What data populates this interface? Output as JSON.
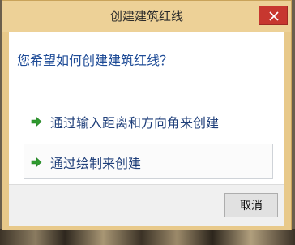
{
  "dialog": {
    "title": "创建建筑红线",
    "question": "您希望如何创建建筑红线？",
    "options": [
      {
        "label": "通过输入距离和方向角来创建"
      },
      {
        "label": "通过绘制来创建"
      }
    ],
    "cancel_label": "取消"
  },
  "icons": {
    "close": "close-icon",
    "option_arrow": "green-arrow-icon"
  },
  "colors": {
    "accent_frame": "#e8c98a",
    "close_button": "#c7372f",
    "question_text": "#1f4c97",
    "option_text": "#1f3f7a",
    "arrow_green": "#2f9a2f"
  }
}
